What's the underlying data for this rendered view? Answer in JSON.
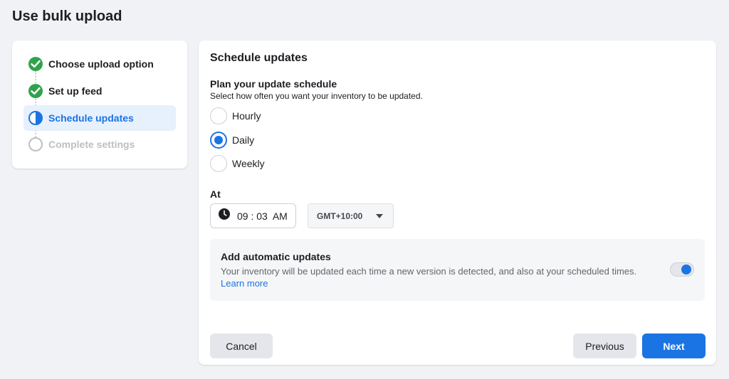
{
  "page": {
    "title": "Use bulk upload"
  },
  "steps": [
    {
      "label": "Choose upload option",
      "state": "done"
    },
    {
      "label": "Set up feed",
      "state": "done"
    },
    {
      "label": "Schedule updates",
      "state": "active"
    },
    {
      "label": "Complete settings",
      "state": "pending"
    }
  ],
  "schedule": {
    "title": "Schedule updates",
    "plan_title": "Plan your update schedule",
    "plan_desc": "Select how often you want your inventory to be updated.",
    "options": [
      {
        "label": "Hourly",
        "checked": false
      },
      {
        "label": "Daily",
        "checked": true
      },
      {
        "label": "Weekly",
        "checked": false
      }
    ],
    "at_label": "At",
    "time_value": "09 : 03  AM",
    "timezone": "GMT+10:00"
  },
  "auto_updates": {
    "title": "Add automatic updates",
    "desc": "Your inventory will be updated each time a new version is detected, and also at your scheduled times.",
    "link": "Learn more",
    "enabled": true
  },
  "buttons": {
    "cancel": "Cancel",
    "previous": "Previous",
    "next": "Next"
  },
  "colors": {
    "accent": "#1b74e4",
    "success": "#31a24c",
    "background": "#f0f2f5"
  }
}
